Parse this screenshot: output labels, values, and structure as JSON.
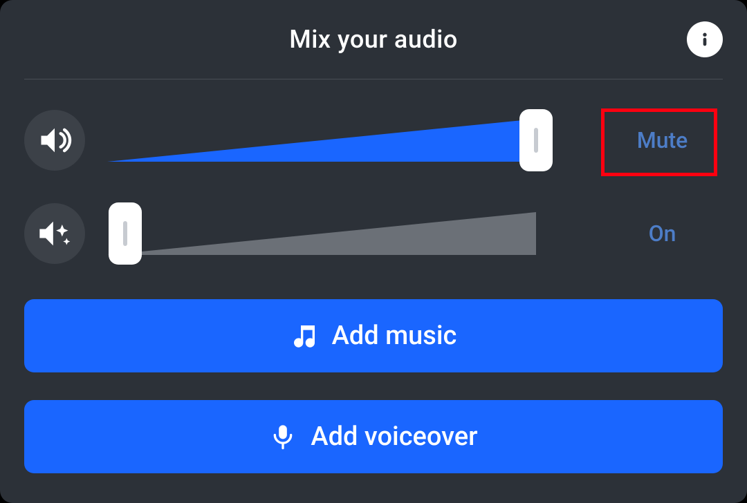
{
  "header": {
    "title": "Mix your audio"
  },
  "sliders": {
    "main": {
      "action_label": "Mute",
      "value_pct": 96
    },
    "effects": {
      "action_label": "On",
      "value_pct": 4
    }
  },
  "buttons": {
    "add_music_label": "Add music",
    "add_voiceover_label": "Add voiceover"
  }
}
